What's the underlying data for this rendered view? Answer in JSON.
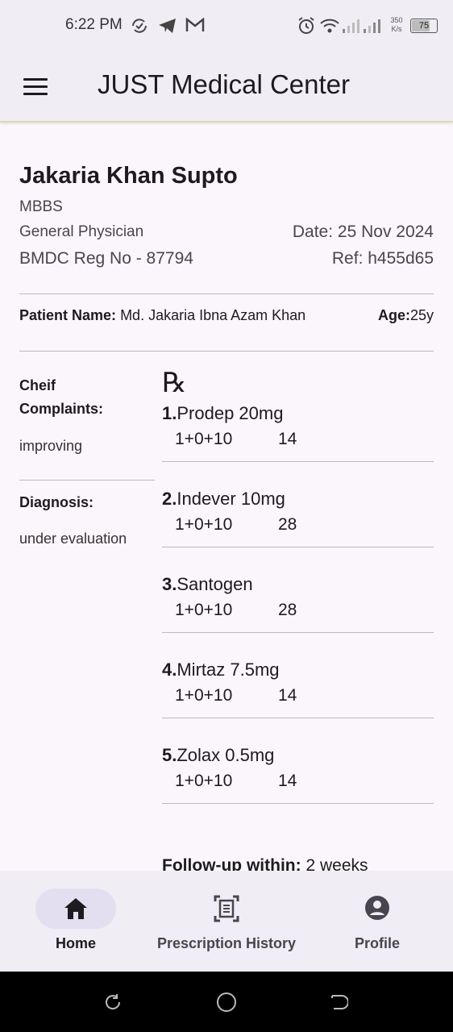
{
  "status_bar": {
    "time": "6:22 PM",
    "net_speed_top": "350",
    "net_speed_bottom": "K/s",
    "battery": "75"
  },
  "app_bar": {
    "title": "JUST Medical Center",
    "menu_icon": "menu-icon"
  },
  "doctor": {
    "name": "Jakaria Khan Supto",
    "degree": "MBBS",
    "specialty": "General Physician",
    "reg": "BMDC Reg No - 87794",
    "date": "Date: 25 Nov 2024",
    "ref": "Ref: h455d65"
  },
  "patient": {
    "name_label": "Patient Name:",
    "name_value": "Md. Jakaria Ibna Azam Khan",
    "age_label": "Age:",
    "age_value": "25y"
  },
  "complaints": {
    "label_line1": "Cheif",
    "label_line2": "Complaints:",
    "value": "improving"
  },
  "diagnosis": {
    "label": "Diagnosis:",
    "value": "under evaluation"
  },
  "rx_symbol": "℞",
  "medicines": [
    {
      "num": "1.",
      "name": "Prodep 20mg",
      "dose": "1+0+10",
      "qty": "14"
    },
    {
      "num": "2.",
      "name": "Indever 10mg",
      "dose": "1+0+10",
      "qty": "28"
    },
    {
      "num": "3.",
      "name": "Santogen",
      "dose": "1+0+10",
      "qty": "28"
    },
    {
      "num": "4.",
      "name": "Mirtaz 7.5mg",
      "dose": "1+0+10",
      "qty": "14"
    },
    {
      "num": "5.",
      "name": "Zolax 0.5mg",
      "dose": "1+0+10",
      "qty": "14"
    }
  ],
  "follow_up": {
    "label": "Follow-up within:",
    "value": "2 weeks"
  },
  "bottom_nav": [
    {
      "label": "Home",
      "icon": "home-icon",
      "selected": true
    },
    {
      "label": "Prescription History",
      "icon": "document-scan-icon",
      "selected": false
    },
    {
      "label": "Profile",
      "icon": "account-circle-icon",
      "selected": false
    }
  ],
  "colors": {
    "surface": "#f0edf5",
    "background": "#fbf6fb",
    "selected_pill": "#e4dff0",
    "appbar_border": "#d8dcb0"
  }
}
